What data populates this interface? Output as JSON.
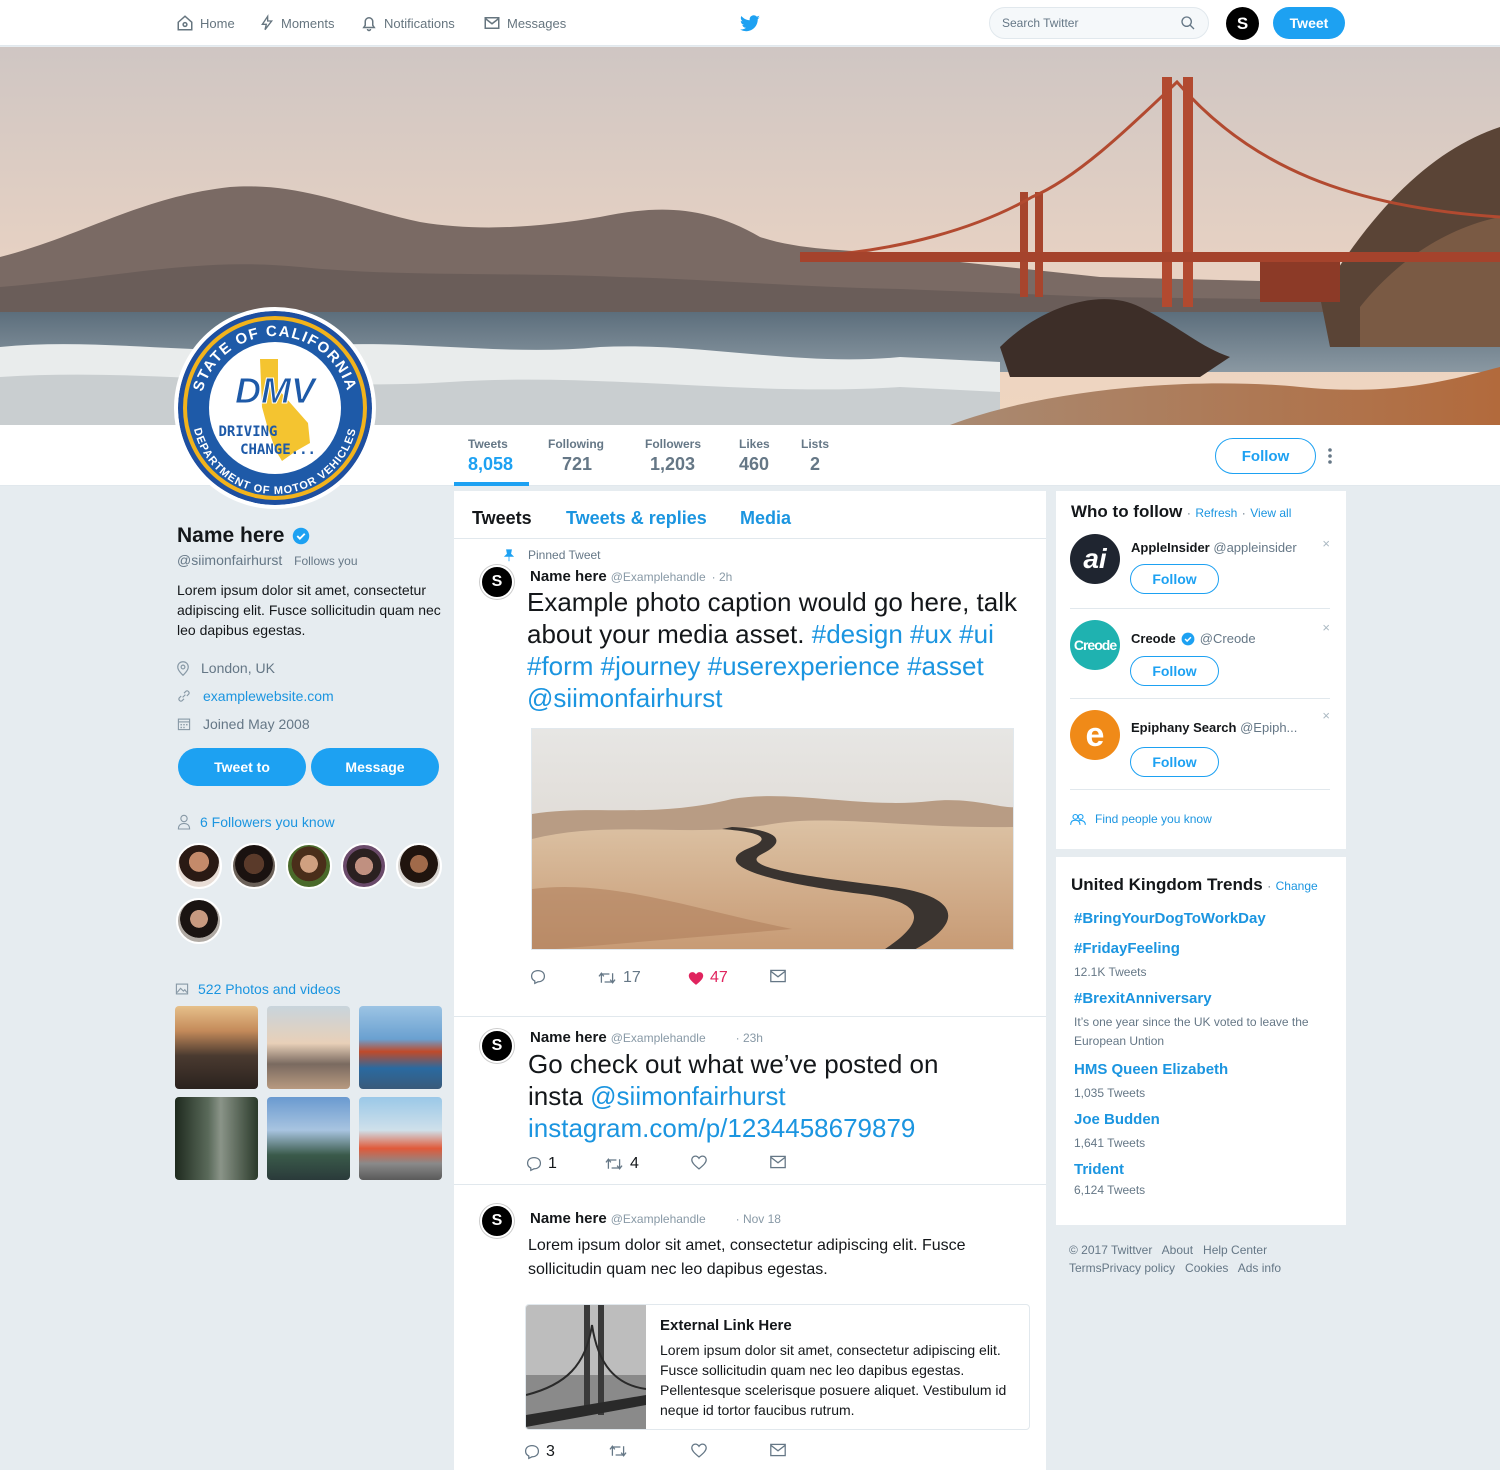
{
  "nav": {
    "home": "Home",
    "moments": "Moments",
    "notifications": "Notifications",
    "messages": "Messages",
    "search_placeholder": "Search Twitter",
    "avatar_letter": "S",
    "tweet_button": "Tweet"
  },
  "stats": [
    {
      "label": "Tweets",
      "value": "8,058"
    },
    {
      "label": "Following",
      "value": "721"
    },
    {
      "label": "Followers",
      "value": "1,203"
    },
    {
      "label": "Likes",
      "value": "460"
    },
    {
      "label": "Lists",
      "value": "2"
    }
  ],
  "follow_button": "Follow",
  "avatar_logo": {
    "ring_top": "STATE OF CALIFORNIA",
    "ring_bottom": "DEPARTMENT OF MOTOR VEHICLES",
    "mark": "DMV",
    "tagline_1": "DRIVING",
    "tagline_2": "CHANGE..."
  },
  "profile": {
    "name": "Name here",
    "handle": "@siimonfairhurst",
    "follows_you": "Follows you",
    "bio": "Lorem ipsum dolor sit amet, consectetur adipiscing elit. Fusce sollicitudin quam nec leo dapibus egestas.",
    "location": "London, UK",
    "website": "examplewebsite.com",
    "joined": "Joined May 2008",
    "tweet_to": "Tweet to",
    "message": "Message",
    "followers_you_know": "6 Followers you know",
    "photos_videos": "522 Photos and videos"
  },
  "timeline": {
    "tabs": [
      "Tweets",
      "Tweets & replies",
      "Media"
    ],
    "tweets": [
      {
        "pinned": "Pinned Tweet",
        "avatar": "S",
        "name": "Name here",
        "handle": "@Examplehandle",
        "time": "· 2h",
        "text_plain": "Example photo caption would go here, talk about your media asset.",
        "text_link": "#design #ux #ui #form #journey #userexperience #asset @siimonfairhurst",
        "replies": "",
        "retweets": "17",
        "likes": "47"
      },
      {
        "avatar": "S",
        "name": "Name here",
        "handle": "@Examplehandle",
        "time": "· 23h",
        "text_plain": "Go check out what we’ve posted on insta",
        "text_link": "@siimonfairhurst instagram.com/p/1234458679879",
        "replies": "1",
        "retweets": "4",
        "likes": ""
      },
      {
        "avatar": "S",
        "name": "Name here",
        "handle": "@Examplehandle",
        "time": "· Nov 18",
        "text": "Lorem ipsum dolor sit amet, consectetur adipiscing elit. Fusce sollicitudin quam nec leo dapibus egestas.",
        "card_title": "External Link Here",
        "card_text": "Lorem ipsum dolor sit amet, consectetur adipiscing elit. Fusce sollicitudin quam nec leo dapibus egestas. Pellentesque scelerisque posuere aliquet. Vestibulum id neque id tortor faucibus rutrum.",
        "replies": "3",
        "retweets": "",
        "likes": ""
      }
    ]
  },
  "who_to_follow": {
    "title": "Who to follow",
    "refresh": "Refresh",
    "view_all": "View all",
    "dot": "·",
    "close": "×",
    "items": [
      {
        "logo": "ai",
        "name": "AppleInsider",
        "handle": "@appleinsider",
        "button": "Follow"
      },
      {
        "logo": "Creode",
        "name": "Creode",
        "handle": "@Creode",
        "button": "Follow"
      },
      {
        "logo": "e",
        "name": "Epiphany Search",
        "handle": "@Epiph...",
        "button": "Follow"
      }
    ],
    "find_people": "Find people you know"
  },
  "trends": {
    "title": "United Kingdom Trends",
    "change": "Change",
    "dot": "·",
    "items": [
      {
        "name": "#BringYourDogToWorkDay",
        "count": ""
      },
      {
        "name": "#FridayFeeling",
        "count": "12.1K Tweets"
      },
      {
        "name": "#BrexitAnniversary",
        "count": "It’s one year since the UK voted to leave the European Untion"
      },
      {
        "name": "HMS Queen Elizabeth",
        "count": "1,035 Tweets"
      },
      {
        "name": "Joe Budden",
        "count": "1,641 Tweets"
      },
      {
        "name": "Trident",
        "count": "6,124 Tweets"
      }
    ]
  },
  "footer": {
    "line1": "© 2017 Twittver   About   Help Center",
    "line2": "TermsPrivacy policy   Cookies   Ads info"
  },
  "colors": {
    "accent": "#1da1f2",
    "link": "#1b95e0",
    "like": "#e0245e",
    "background": "#e6ecf0"
  }
}
